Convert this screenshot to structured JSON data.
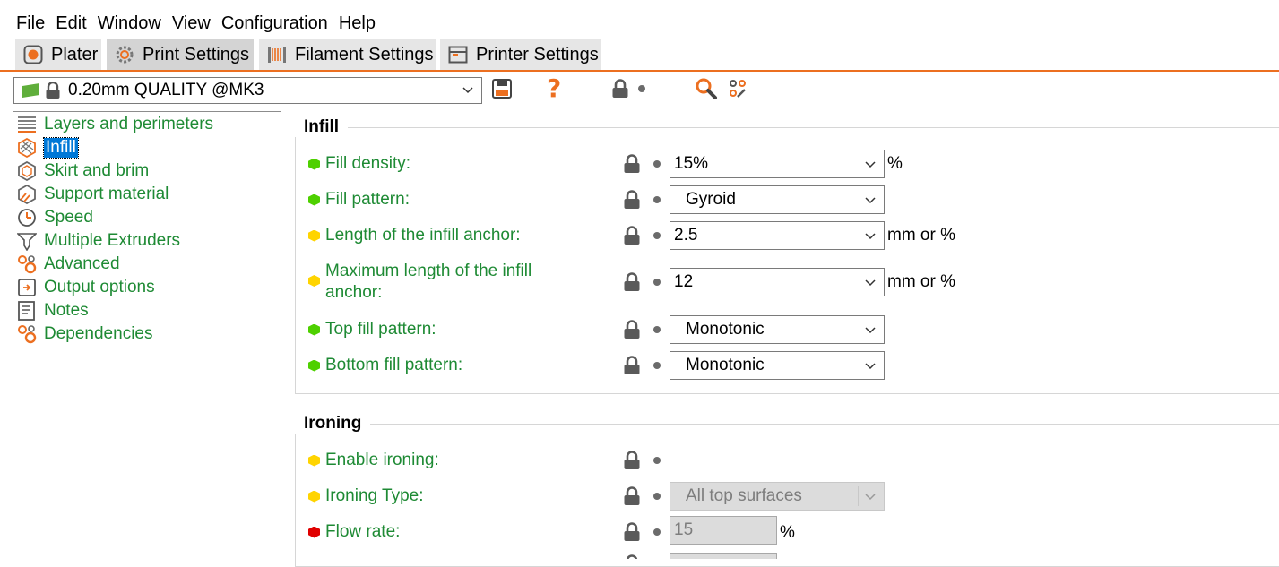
{
  "menu": [
    "File",
    "Edit",
    "Window",
    "View",
    "Configuration",
    "Help"
  ],
  "tabs": [
    {
      "label": "Plater",
      "icon": "plater-icon"
    },
    {
      "label": "Print Settings",
      "icon": "gear-icon"
    },
    {
      "label": "Filament Settings",
      "icon": "filament-spool-icon"
    },
    {
      "label": "Printer Settings",
      "icon": "printer-icon"
    }
  ],
  "preset": {
    "name": "0.20mm QUALITY @MK3"
  },
  "sidebar": {
    "items": [
      {
        "label": "Layers and perimeters",
        "icon": "layers-icon"
      },
      {
        "label": "Infill",
        "icon": "infill-icon",
        "selected": true
      },
      {
        "label": "Skirt and brim",
        "icon": "skirt-icon"
      },
      {
        "label": "Support material",
        "icon": "support-icon"
      },
      {
        "label": "Speed",
        "icon": "speed-icon"
      },
      {
        "label": "Multiple Extruders",
        "icon": "extruder-icon"
      },
      {
        "label": "Advanced",
        "icon": "advanced-icon"
      },
      {
        "label": "Output options",
        "icon": "output-icon"
      },
      {
        "label": "Notes",
        "icon": "notes-icon"
      },
      {
        "label": "Dependencies",
        "icon": "dependencies-icon"
      }
    ]
  },
  "infill": {
    "title": "Infill",
    "options": [
      {
        "label": "Fill density:",
        "value": "15%",
        "unit": "%",
        "level": "green"
      },
      {
        "label": "Fill pattern:",
        "value": "Gyroid",
        "unit": "",
        "level": "green"
      },
      {
        "label": "Length of the infill anchor:",
        "value": "2.5",
        "unit": "mm or %",
        "level": "yellow"
      },
      {
        "label_line1": "Maximum length of the infill",
        "label_line2": "anchor:",
        "value": "12",
        "unit": "mm or %",
        "level": "yellow"
      },
      {
        "label": "Top fill pattern:",
        "value": "Monotonic",
        "unit": "",
        "level": "green"
      },
      {
        "label": "Bottom fill pattern:",
        "value": "Monotonic",
        "unit": "",
        "level": "green"
      }
    ]
  },
  "ironing": {
    "title": "Ironing",
    "options": [
      {
        "label": "Enable ironing:",
        "checked": false,
        "level": "yellow"
      },
      {
        "label": "Ironing Type:",
        "value": "All top surfaces",
        "level": "yellow"
      },
      {
        "label": "Flow rate:",
        "value": "15",
        "unit": "%",
        "level": "red"
      }
    ]
  },
  "colors": {
    "accent": "#ec6f20",
    "label_green": "#1e8a34",
    "selection": "#0078d7"
  }
}
